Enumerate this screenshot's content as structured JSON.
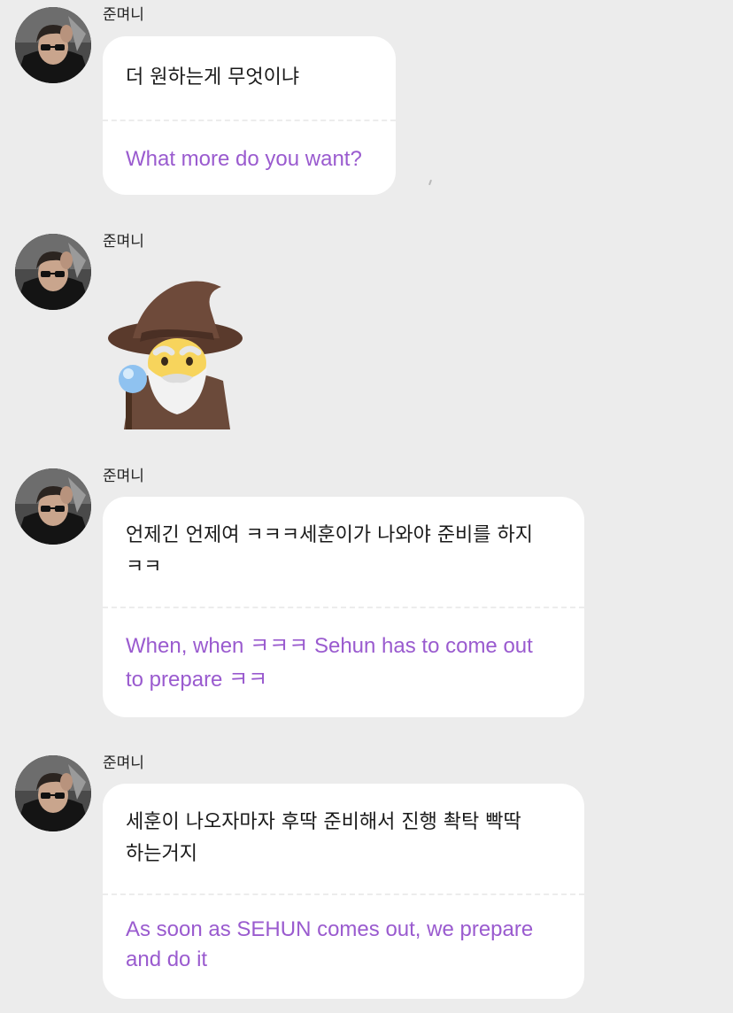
{
  "messages": [
    {
      "sender": "준며니",
      "text": "더 원하는게 무엇이냐",
      "translation": "What more do you want?"
    },
    {
      "sender": "준며니",
      "emoji": "mage-emoji"
    },
    {
      "sender": "준며니",
      "text_lines": [
        "언제긴 언제여 ㅋㅋㅋ세훈이가 나와야 준비를 하지",
        "ㅋㅋ"
      ],
      "translation_lines": [
        "When, when ㅋㅋㅋ Sehun has to come out",
        "to prepare ㅋㅋ"
      ]
    },
    {
      "sender": "준며니",
      "text_lines": [
        "세훈이 나오자마자 후딱 준비해서 진행 촥탁 빡딱",
        "하는거지"
      ],
      "translation_lines": [
        "As soon as SEHUN comes out, we prepare",
        "and do it"
      ]
    }
  ],
  "colors": {
    "background": "#ececec",
    "bubble": "#ffffff",
    "translation_text": "#9a5bcf"
  }
}
